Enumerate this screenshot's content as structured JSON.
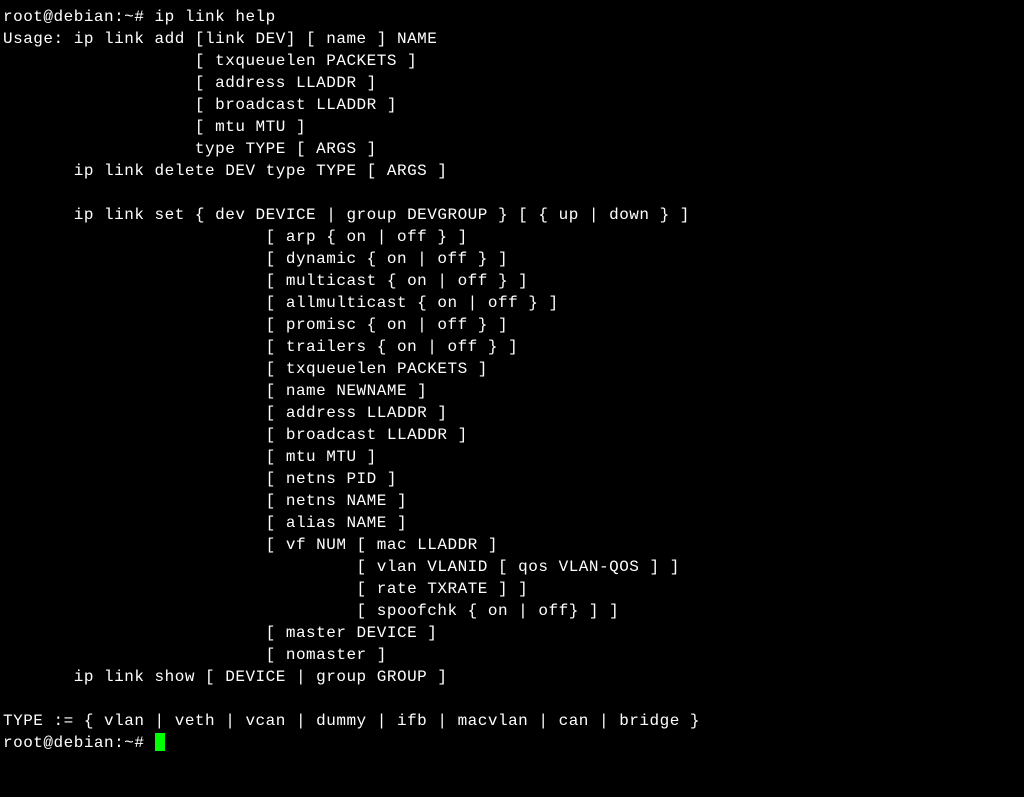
{
  "prompt1": "root@debian:~# ",
  "command1": "ip link help",
  "usage_lines": [
    "Usage: ip link add [link DEV] [ name ] NAME",
    "                   [ txqueuelen PACKETS ]",
    "                   [ address LLADDR ]",
    "                   [ broadcast LLADDR ]",
    "                   [ mtu MTU ]",
    "                   type TYPE [ ARGS ]",
    "       ip link delete DEV type TYPE [ ARGS ]",
    "",
    "       ip link set { dev DEVICE | group DEVGROUP } [ { up | down } ]",
    "                          [ arp { on | off } ]",
    "                          [ dynamic { on | off } ]",
    "                          [ multicast { on | off } ]",
    "                          [ allmulticast { on | off } ]",
    "                          [ promisc { on | off } ]",
    "                          [ trailers { on | off } ]",
    "                          [ txqueuelen PACKETS ]",
    "                          [ name NEWNAME ]",
    "                          [ address LLADDR ]",
    "                          [ broadcast LLADDR ]",
    "                          [ mtu MTU ]",
    "                          [ netns PID ]",
    "                          [ netns NAME ]",
    "                          [ alias NAME ]",
    "                          [ vf NUM [ mac LLADDR ]",
    "                                   [ vlan VLANID [ qos VLAN-QOS ] ]",
    "                                   [ rate TXRATE ] ]",
    "                                   [ spoofchk { on | off} ] ]",
    "                          [ master DEVICE ]",
    "                          [ nomaster ]",
    "       ip link show [ DEVICE | group GROUP ]",
    "",
    "TYPE := { vlan | veth | vcan | dummy | ifb | macvlan | can | bridge }"
  ],
  "prompt2": "root@debian:~# "
}
